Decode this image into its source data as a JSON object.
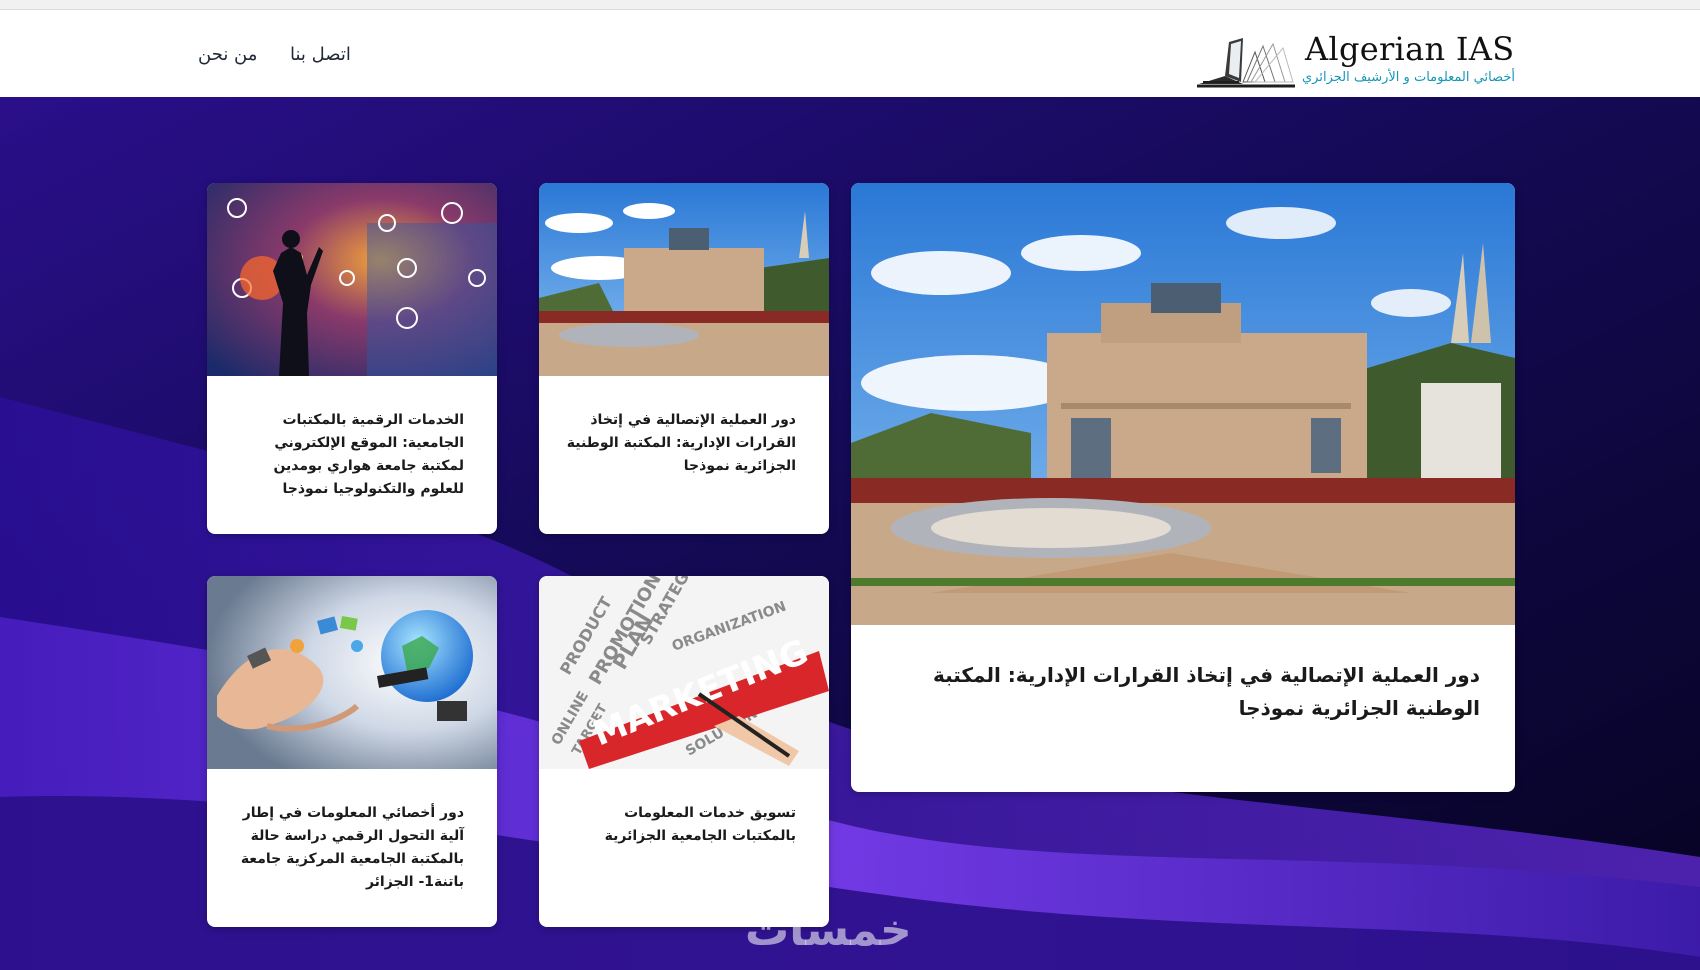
{
  "header": {
    "logo_title": "Algerian IAS",
    "logo_subtitle": "أخصائي المعلومات و الأرشيف الجزائري",
    "nav": [
      {
        "label": "اتصل بنا"
      },
      {
        "label": "من نحن"
      }
    ]
  },
  "featured": {
    "title": "دور العملية الإتصالية في إتخاذ القرارات الإدارية: المكتبة الوطنية الجزائرية نموذجا",
    "image_icon": "library-building-photo"
  },
  "posts": [
    {
      "title": "دور العملية الإتصالية في إتخاذ القرارات الإدارية: المكتبة الوطنية الجزائرية نموذجا",
      "image_icon": "library-building-photo"
    },
    {
      "title": "الخدمات الرقمية بالمكتبات الجامعية: الموقع الإلكتروني لمكتبة جامعة هواري بومدين للعلوم والتكنولوجيا نموذجا",
      "image_icon": "digital-city-photo"
    },
    {
      "title": "تسويق خدمات المعلومات بالمكتبات الجامعية الجزائرية",
      "image_icon": "marketing-words-photo"
    },
    {
      "title": "دور أخصائي المعلومات في إطار آلية التحول الرقمي دراسة حالة بالمكتبة الجامعية المركزية جامعة باتنة1- الجزائر",
      "image_icon": "digital-globe-hand-photo"
    }
  ],
  "watermark": "خمسات",
  "colors": {
    "accent": "#1697b7",
    "hero_dark": "#0b0633",
    "hero_purple": "#5b2ad6"
  }
}
